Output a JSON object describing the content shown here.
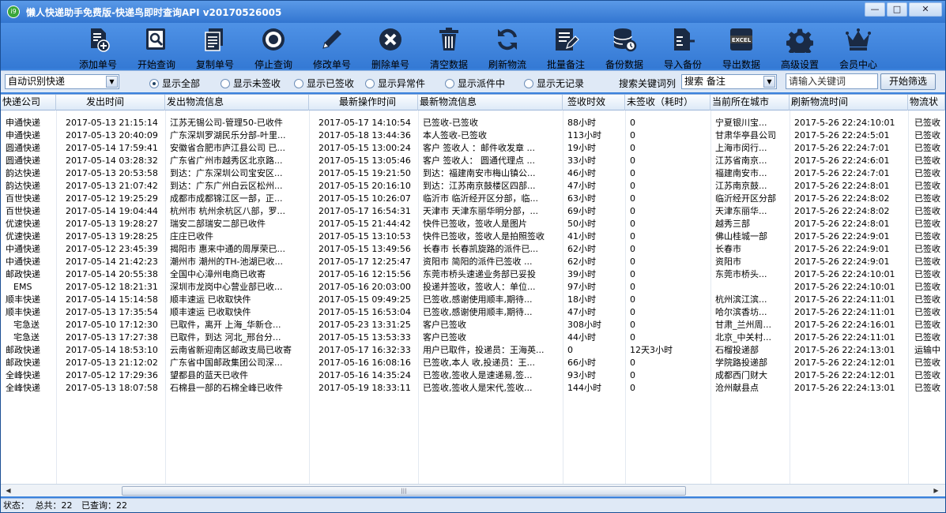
{
  "window": {
    "title": "懒人快递助手免费版-快递鸟即时查询API v20170526005",
    "icon_text": "i9",
    "min": "—",
    "max": "□",
    "close": "✕"
  },
  "toolbar": [
    {
      "label": "添加单号",
      "icon": "add-document-icon"
    },
    {
      "label": "开始查询",
      "icon": "search-icon"
    },
    {
      "label": "复制单号",
      "icon": "copy-icon"
    },
    {
      "label": "停止查询",
      "icon": "stop-icon"
    },
    {
      "label": "修改单号",
      "icon": "pencil-icon"
    },
    {
      "label": "删除单号",
      "icon": "delete-icon"
    },
    {
      "label": "清空数据",
      "icon": "trash-icon"
    },
    {
      "label": "刷新物流",
      "icon": "refresh-icon"
    },
    {
      "label": "批量备注",
      "icon": "note-icon"
    },
    {
      "label": "备份数据",
      "icon": "database-icon"
    },
    {
      "label": "导入备份",
      "icon": "import-icon"
    },
    {
      "label": "导出数据",
      "icon": "excel-icon"
    },
    {
      "label": "高级设置",
      "icon": "gear-icon"
    },
    {
      "label": "会员中心",
      "icon": "crown-icon"
    }
  ],
  "filter": {
    "courier_select": "自动识别快递",
    "radios": [
      {
        "label": "显示全部",
        "checked": true
      },
      {
        "label": "显示未签收",
        "checked": false
      },
      {
        "label": "显示已签收",
        "checked": false
      },
      {
        "label": "显示异常件",
        "checked": false
      },
      {
        "label": "显示派件中",
        "checked": false
      },
      {
        "label": "显示无记录",
        "checked": false
      }
    ],
    "keyword_column_label": "搜索关键词列",
    "keyword_column_value": "搜索 备注",
    "keyword_placeholder": "请输入关键词",
    "filter_button": "开始筛选"
  },
  "table": {
    "columns": [
      "快递公司",
      "发出时间",
      "发出物流信息",
      "最新操作时间",
      "最新物流信息",
      "签收时效",
      "未签收（耗时）",
      "当前所在城市",
      "刷新物流时间",
      "物流状"
    ],
    "rows": [
      [
        "申通快递",
        "2017-05-13 21:15:14",
        "江苏无锡公司-管理50-已收件",
        "2017-05-17 14:10:54",
        "已签收-已签收",
        "88小时",
        "0",
        "宁夏银川宝...",
        "2017-5-26 22:24:10:01",
        "已签收"
      ],
      [
        "申通快递",
        "2017-05-13 20:40:09",
        "广东深圳罗湖民乐分部-叶里...",
        "2017-05-18 13:44:36",
        "本人签收-已签收",
        "113小时",
        "0",
        "甘肃华亭县公司",
        "2017-5-26 22:24:5:01",
        "已签收"
      ],
      [
        "圆通快递",
        "2017-05-14 17:59:41",
        "安徽省合肥市庐江县公司 已...",
        "2017-05-15 13:00:24",
        "客户 签收人 ：邮件收发章 ...",
        "19小时",
        "0",
        "上海市闵行...",
        "2017-5-26 22:24:7:01",
        "已签收"
      ],
      [
        "圆通快递",
        "2017-05-14 03:28:32",
        "广东省广州市越秀区北京路...",
        "2017-05-15 13:05:46",
        "客户 签收人： 圆通代理点 ...",
        "33小时",
        "0",
        "江苏省南京...",
        "2017-5-26 22:24:6:01",
        "已签收"
      ],
      [
        "韵达快递",
        "2017-05-13 20:53:58",
        "到达：广东深圳公司宝安区...",
        "2017-05-15 19:21:50",
        "到达：福建南安市梅山镇公...",
        "46小时",
        "0",
        "福建南安市...",
        "2017-5-26 22:24:7:01",
        "已签收"
      ],
      [
        "韵达快递",
        "2017-05-13 21:07:42",
        "到达：广东广州白云区松州...",
        "2017-05-15 20:16:10",
        "到达：江苏南京鼓楼区四部...",
        "47小时",
        "0",
        "江苏南京鼓...",
        "2017-5-26 22:24:8:01",
        "已签收"
      ],
      [
        "百世快递",
        "2017-05-12 19:25:29",
        "成都市成都锦江区一部，正...",
        "2017-05-15 10:26:07",
        "临沂市 临沂经开区分部，临...",
        "63小时",
        "0",
        "临沂经开区分部",
        "2017-5-26 22:24:8:02",
        "已签收"
      ],
      [
        "百世快递",
        "2017-05-14 19:04:44",
        "杭州市 杭州余杭区八部，罗...",
        "2017-05-17 16:54:31",
        "天津市 天津东丽华明分部，...",
        "69小时",
        "0",
        "天津东丽华...",
        "2017-5-26 22:24:8:02",
        "已签收"
      ],
      [
        "优速快递",
        "2017-05-13 19:28:27",
        "瑞安二部瑞安二部已收件",
        "2017-05-15 21:44:42",
        "快件已签收，签收人是图片",
        "50小时",
        "0",
        "越秀三部",
        "2017-5-26 22:24:8:01",
        "已签收"
      ],
      [
        "优速快递",
        "2017-05-13 19:28:25",
        "庄庄已收件",
        "2017-05-15 13:10:53",
        "快件已签收，签收人是拍照签收",
        "41小时",
        "0",
        "佛山桂城一部",
        "2017-5-26 22:24:9:01",
        "已签收"
      ],
      [
        "中通快递",
        "2017-05-12 23:45:39",
        "揭阳市 惠来中通的周厚荣已...",
        "2017-05-15 13:49:56",
        "长春市 长春凯旋路的派件已...",
        "62小时",
        "0",
        "长春市",
        "2017-5-26 22:24:9:01",
        "已签收"
      ],
      [
        "中通快递",
        "2017-05-14 21:42:23",
        "潮州市 潮州的TH-池湖已收...",
        "2017-05-17 12:25:47",
        "资阳市 简阳的派件已签收 ...",
        "62小时",
        "0",
        "资阳市",
        "2017-5-26 22:24:9:01",
        "已签收"
      ],
      [
        "邮政快递",
        "2017-05-14 20:55:38",
        "全国中心漳州电商已收寄",
        "2017-05-16 12:15:56",
        "东莞市桥头速递业务部已妥投",
        "39小时",
        "0",
        "东莞市桥头...",
        "2017-5-26 22:24:10:01",
        "已签收"
      ],
      [
        "EMS",
        "2017-05-12 18:21:31",
        "深圳市龙岗中心营业部已收...",
        "2017-05-16 20:03:00",
        "投递并签收，签收人：单位...",
        "97小时",
        "0",
        "",
        "2017-5-26 22:24:10:01",
        "已签收"
      ],
      [
        "顺丰快递",
        "2017-05-14 15:14:58",
        "顺丰速运 已收取快件",
        "2017-05-15 09:49:25",
        "已签收,感谢使用顺丰,期待...",
        "18小时",
        "0",
        "杭州滨江滨...",
        "2017-5-26 22:24:11:01",
        "已签收"
      ],
      [
        "顺丰快递",
        "2017-05-13 17:35:54",
        "顺丰速运 已收取快件",
        "2017-05-15 16:53:04",
        "已签收,感谢使用顺丰,期待...",
        "47小时",
        "0",
        "哈尔滨香坊...",
        "2017-5-26 22:24:11:01",
        "已签收"
      ],
      [
        "宅急送",
        "2017-05-10 17:12:30",
        "已取件，离开 上海_华新仓...",
        "2017-05-23 13:31:25",
        "客户已签收",
        "308小时",
        "0",
        "甘肃_兰州周...",
        "2017-5-26 22:24:16:01",
        "已签收"
      ],
      [
        "宅急送",
        "2017-05-13 17:27:38",
        "已取件，到达 河北_邢台分...",
        "2017-05-15 13:53:33",
        "客户已签收",
        "44小时",
        "0",
        "北京_中关村...",
        "2017-5-26 22:24:11:01",
        "已签收"
      ],
      [
        "邮政快递",
        "2017-05-14 18:53:10",
        "云南省新迎南区邮政支局已收寄",
        "2017-05-17 16:32:33",
        "用户已取件，投递员：王海英...",
        "0",
        "12天3小时",
        "石榴投递部",
        "2017-5-26 22:24:13:01",
        "运输中"
      ],
      [
        "邮政快递",
        "2017-05-13 21:12:02",
        "广东省中国邮政集团公司深...",
        "2017-05-16 16:08:16",
        "已签收,本人 收,投递员：王...",
        "66小时",
        "0",
        "学院路投递部",
        "2017-5-26 22:24:12:01",
        "已签收"
      ],
      [
        "全峰快递",
        "2017-05-12 17:29:36",
        "望都县的蓝天已收件",
        "2017-05-16 14:35:24",
        "已签收,签收人是速递易,签...",
        "93小时",
        "0",
        "成都西门财大",
        "2017-5-26 22:24:12:01",
        "已签收"
      ],
      [
        "全峰快递",
        "2017-05-13 18:07:58",
        "石棉县一部的石棉全峰已收件",
        "2017-05-19 18:33:11",
        "已签收,签收人是宋代,签收...",
        "144小时",
        "0",
        "沧州献县点",
        "2017-5-26 22:24:13:01",
        "已签收"
      ]
    ]
  },
  "scrollbar": {
    "left": "◀",
    "right": "▶",
    "grip": "|||"
  },
  "status": {
    "label": "状态：",
    "total": "总共：22",
    "queried": "已查询：22"
  }
}
